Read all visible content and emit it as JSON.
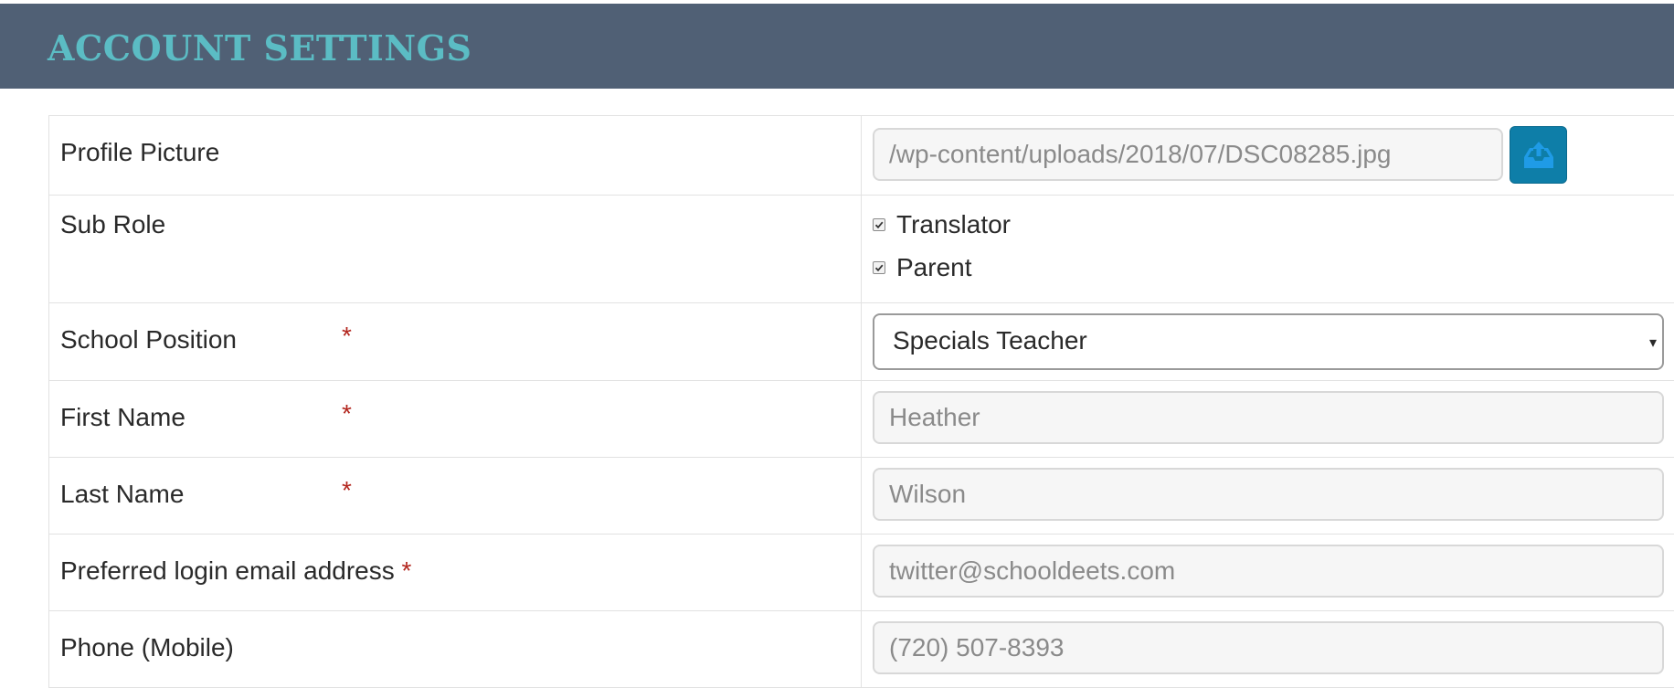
{
  "page": {
    "title": "ACCOUNT SETTINGS"
  },
  "form": {
    "profile_picture": {
      "label": "Profile Picture",
      "value": "/wp-content/uploads/2018/07/DSC08285.jpg",
      "upload_icon": "upload-tray-icon"
    },
    "sub_role": {
      "label": "Sub Role",
      "options": [
        {
          "label": "Translator",
          "checked": true
        },
        {
          "label": "Parent",
          "checked": true
        }
      ]
    },
    "school_position": {
      "label": "School Position",
      "required_mark": "*",
      "selected": "Specials Teacher",
      "caret": "▾"
    },
    "first_name": {
      "label": "First Name",
      "required_mark": "*",
      "value": "Heather"
    },
    "last_name": {
      "label": "Last Name",
      "required_mark": "*",
      "value": "Wilson"
    },
    "email": {
      "label": "Preferred login email address",
      "required_mark": "*",
      "value": "twitter@schooldeets.com"
    },
    "phone": {
      "label": "Phone (Mobile)",
      "value": "(720) 507-8393"
    }
  },
  "colors": {
    "header_bg": "#506075",
    "header_title": "#5bbcc4",
    "required": "#b3261e",
    "upload_button": "#0e7ea8"
  }
}
